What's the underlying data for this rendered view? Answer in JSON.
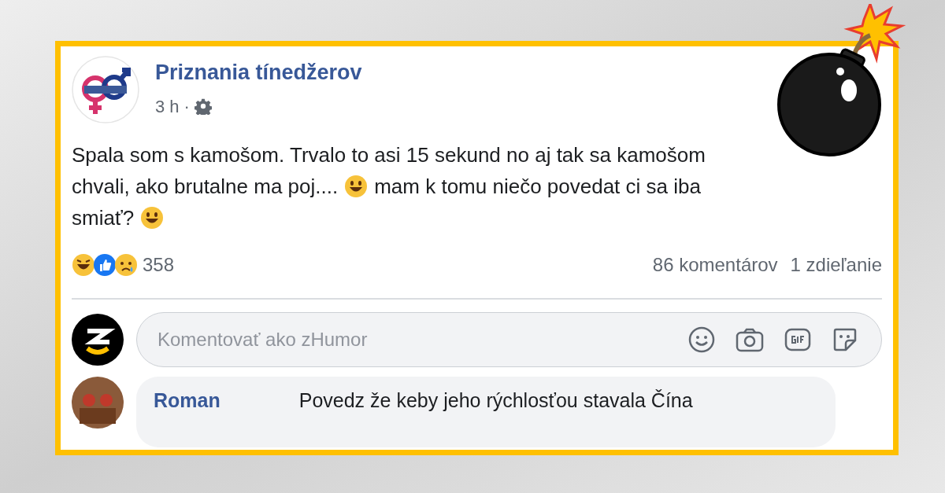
{
  "post": {
    "page_name": "Priznania tínedžerov",
    "time": "3 h",
    "separator": "·",
    "text_lines": [
      [
        {
          "kind": "text",
          "text": "Spala som s kamošom. Trvalo to asi 15 sekund no aj tak sa kamošom"
        }
      ],
      [
        {
          "kind": "text",
          "text": "chvali, ako brutalne ma poj...."
        },
        {
          "kind": "emoji"
        },
        {
          "kind": "text",
          "text": "mam k tomu niečo povedat ci sa iba"
        }
      ],
      [
        {
          "kind": "text",
          "text": "smiať?"
        },
        {
          "kind": "emoji"
        }
      ]
    ],
    "reaction_count": "358",
    "comments_count": "86 komentárov",
    "shares_count": "1 zdieľanie"
  },
  "comment_box": {
    "placeholder": "Komentovať ako zHumor"
  },
  "comments": [
    {
      "author": "Roman",
      "text": "Povedz že keby jeho rýchlosťou stavala Čína"
    }
  ]
}
